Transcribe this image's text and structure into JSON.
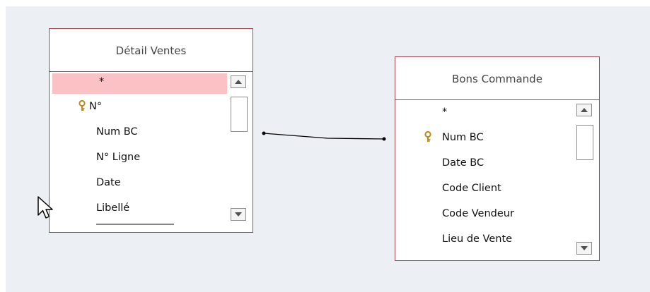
{
  "tables": [
    {
      "title": "Détail Ventes",
      "fields": [
        {
          "label": "*",
          "key": false,
          "selected": true
        },
        {
          "label": "N°",
          "key": true,
          "selected": false
        },
        {
          "label": "Num BC",
          "key": false,
          "selected": false
        },
        {
          "label": "N° Ligne",
          "key": false,
          "selected": false
        },
        {
          "label": "Date",
          "key": false,
          "selected": false
        },
        {
          "label": "Libellé",
          "key": false,
          "selected": false
        }
      ]
    },
    {
      "title": "Bons Commande",
      "fields": [
        {
          "label": "*",
          "key": false,
          "selected": false
        },
        {
          "label": "Num BC",
          "key": true,
          "selected": false
        },
        {
          "label": "Date BC",
          "key": false,
          "selected": false
        },
        {
          "label": "Code Client",
          "key": false,
          "selected": false
        },
        {
          "label": "Code Vendeur",
          "key": false,
          "selected": false
        },
        {
          "label": "Lieu de Vente",
          "key": false,
          "selected": false
        }
      ]
    }
  ],
  "colors": {
    "canvas": "#eceff3",
    "table_border": "#a8434d",
    "selection": "#fbc2c6",
    "key_icon": "#d4a017"
  },
  "icons": {
    "key": "key-icon",
    "scroll_up": "scroll-up-arrow-icon",
    "scroll_down": "scroll-down-arrow-icon",
    "cursor": "mouse-pointer-icon"
  }
}
